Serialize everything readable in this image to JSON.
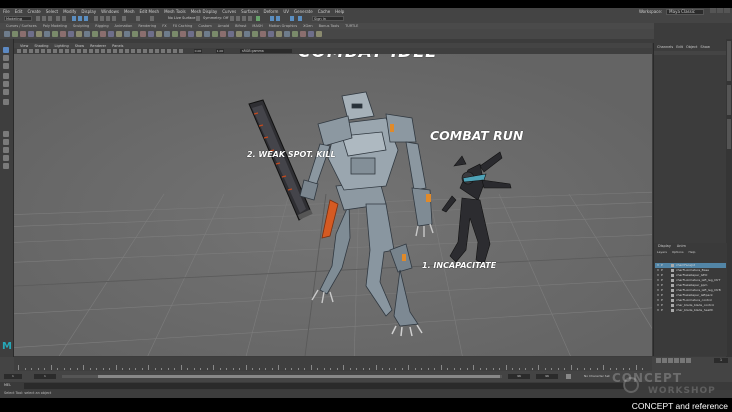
{
  "menubar": {
    "items": [
      "File",
      "Edit",
      "Create",
      "Select",
      "Modify",
      "Display",
      "Windows",
      "Mesh",
      "Edit Mesh",
      "Mesh Tools",
      "Mesh Display",
      "Curves",
      "Surfaces",
      "Deform",
      "UV",
      "Generate",
      "Cache",
      "Help"
    ],
    "workspace_label": "Workspace:",
    "workspace_value": "Maya Classic"
  },
  "statusline": {
    "menu_set": "Modeling",
    "live_surface": "No Live Surface",
    "symmetry": "Symmetry: Off",
    "sign_in": "Sign In"
  },
  "shelf": {
    "tabs": [
      "Curves / Surfaces",
      "Poly Modeling",
      "Sculpting",
      "Rigging",
      "Animation",
      "Rendering",
      "FX",
      "FX Caching",
      "Custom",
      "Arnold",
      "Bifrost",
      "MASH",
      "Motion Graphics",
      "XGen",
      "Bonus Tools",
      "TURTLE"
    ]
  },
  "viewport": {
    "menu": [
      "View",
      "Shading",
      "Lighting",
      "Show",
      "Renderer",
      "Panels"
    ],
    "values": [
      "0.00",
      "1.00"
    ],
    "color_space": "sRGB gamma",
    "annotations": {
      "top": "COMBAT IDLE",
      "run": "COMBAT RUN",
      "weak": "2. WEAK SPOT. KILL",
      "incap": "1. INCAPACITATE"
    }
  },
  "channel_box": {
    "tabs": [
      "Channels",
      "Edit",
      "Object",
      "Show"
    ]
  },
  "layer_editor": {
    "tabs": [
      "Display",
      "Anim"
    ],
    "menu": [
      "Layers",
      "Options",
      "Help"
    ],
    "layers": [
      {
        "v": "V",
        "p": "P",
        "name": "chamFaceJnt",
        "selected": true
      },
      {
        "v": "V",
        "p": "P",
        "name": "charFLArmature_Base",
        "selected": false
      },
      {
        "v": "V",
        "p": "P",
        "name": "charFlakeKaper_GEO",
        "selected": false
      },
      {
        "v": "V",
        "p": "P",
        "name": "charFLArmature_left_leg_CtrT",
        "selected": false
      },
      {
        "v": "V",
        "p": "P",
        "name": "charFlakeKaper_ppm",
        "selected": false
      },
      {
        "v": "V",
        "p": "P",
        "name": "charFLArmature_left_leg_CtrB",
        "selected": false
      },
      {
        "v": "V",
        "p": "P",
        "name": "charFlakeKaper_leftpack",
        "selected": false
      },
      {
        "v": "V",
        "p": "P",
        "name": "charFLArmature_control",
        "selected": false
      },
      {
        "v": "V",
        "p": "P",
        "name": "char_blade_blade_control",
        "selected": false
      },
      {
        "v": "V",
        "p": "P",
        "name": "char_blade_blade_health",
        "selected": false
      }
    ]
  },
  "timeline": {
    "current_frame": "1",
    "range_start": "1",
    "range_inner_start": "1",
    "range_inner_end": "96",
    "range_end": "96",
    "character_set": "No Character Set",
    "anim_layer": "No Anim Layer"
  },
  "command_line": {
    "label": "MEL"
  },
  "help_line": {
    "text": "Select Tool: select an object"
  },
  "watermark": {
    "line1": "CONCEPT",
    "line2": "WORKSHOP"
  },
  "caption": "CONCEPT and reference",
  "colors": {
    "viewport_bg": "#6b6b6b",
    "ui_panel": "#3c3c3c",
    "selection": "#5285a6",
    "maya_logo": "#26a7b7"
  }
}
